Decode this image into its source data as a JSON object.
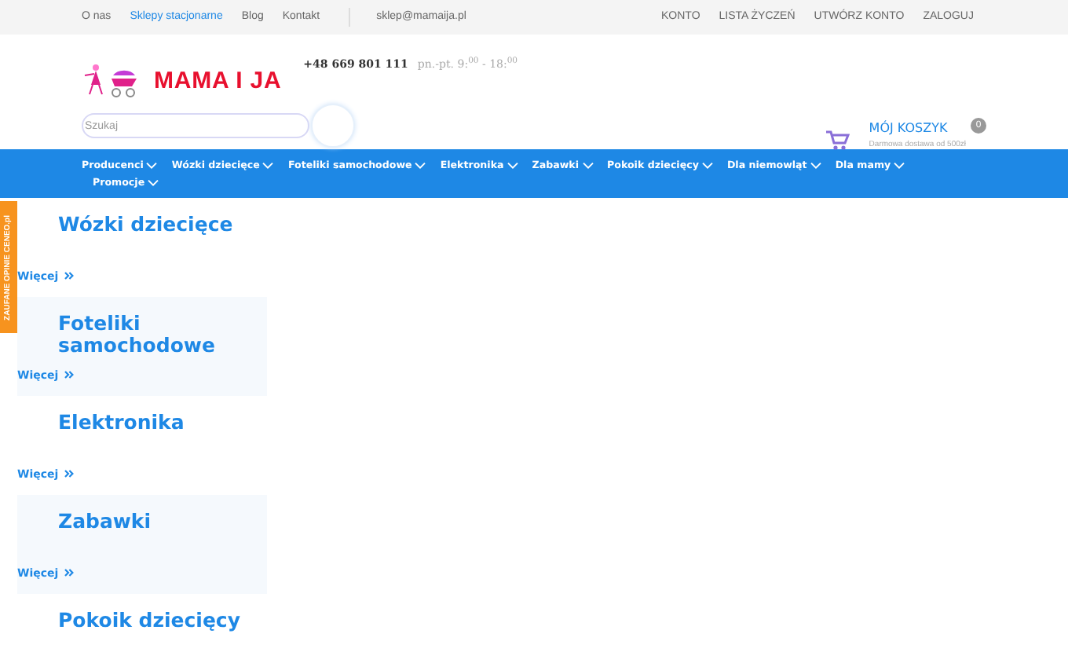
{
  "top_bar": {
    "links": [
      {
        "label": "O nas",
        "selected": false
      },
      {
        "label": "Sklepy stacjonarne",
        "selected": true
      },
      {
        "label": "Blog",
        "selected": false
      },
      {
        "label": "Kontakt",
        "selected": false
      }
    ],
    "email": "sklep@mamaija.pl",
    "account_links": [
      "KONTO",
      "LISTA ŻYCZEŃ",
      "UTWÓRZ KONTO",
      "ZALOGUJ"
    ]
  },
  "header": {
    "logo_text": "MAMA I JA",
    "phone": "+48 669 801 111",
    "hours": "pn.-pt. 9:$^{00}$ - 18:$^{00}$",
    "search": {
      "placeholder": "Szukaj"
    },
    "cart": {
      "title": "MÓJ KOSZYK",
      "count": "0",
      "note": "Darmowa dostawa od 500zł"
    }
  },
  "nav": [
    "Producenci",
    "Wózki dziecięce",
    "Foteliki samochodowe",
    "Elektronika",
    "Zabawki",
    "Pokoik dziecięcy",
    "Dla niemowląt",
    "Dla mamy",
    "Promocje"
  ],
  "side_badge": "ZAUFANE OPINIE CENEO.pl",
  "categories": [
    {
      "title": "Wózki dziecięce",
      "more": "Więcej"
    },
    {
      "title": "Foteliki samochodowe",
      "more": "Więcej"
    },
    {
      "title": "Elektronika",
      "more": "Więcej"
    },
    {
      "title": "Zabawki",
      "more": "Więcej"
    },
    {
      "title": "Pokoik dziecięcy"
    }
  ]
}
